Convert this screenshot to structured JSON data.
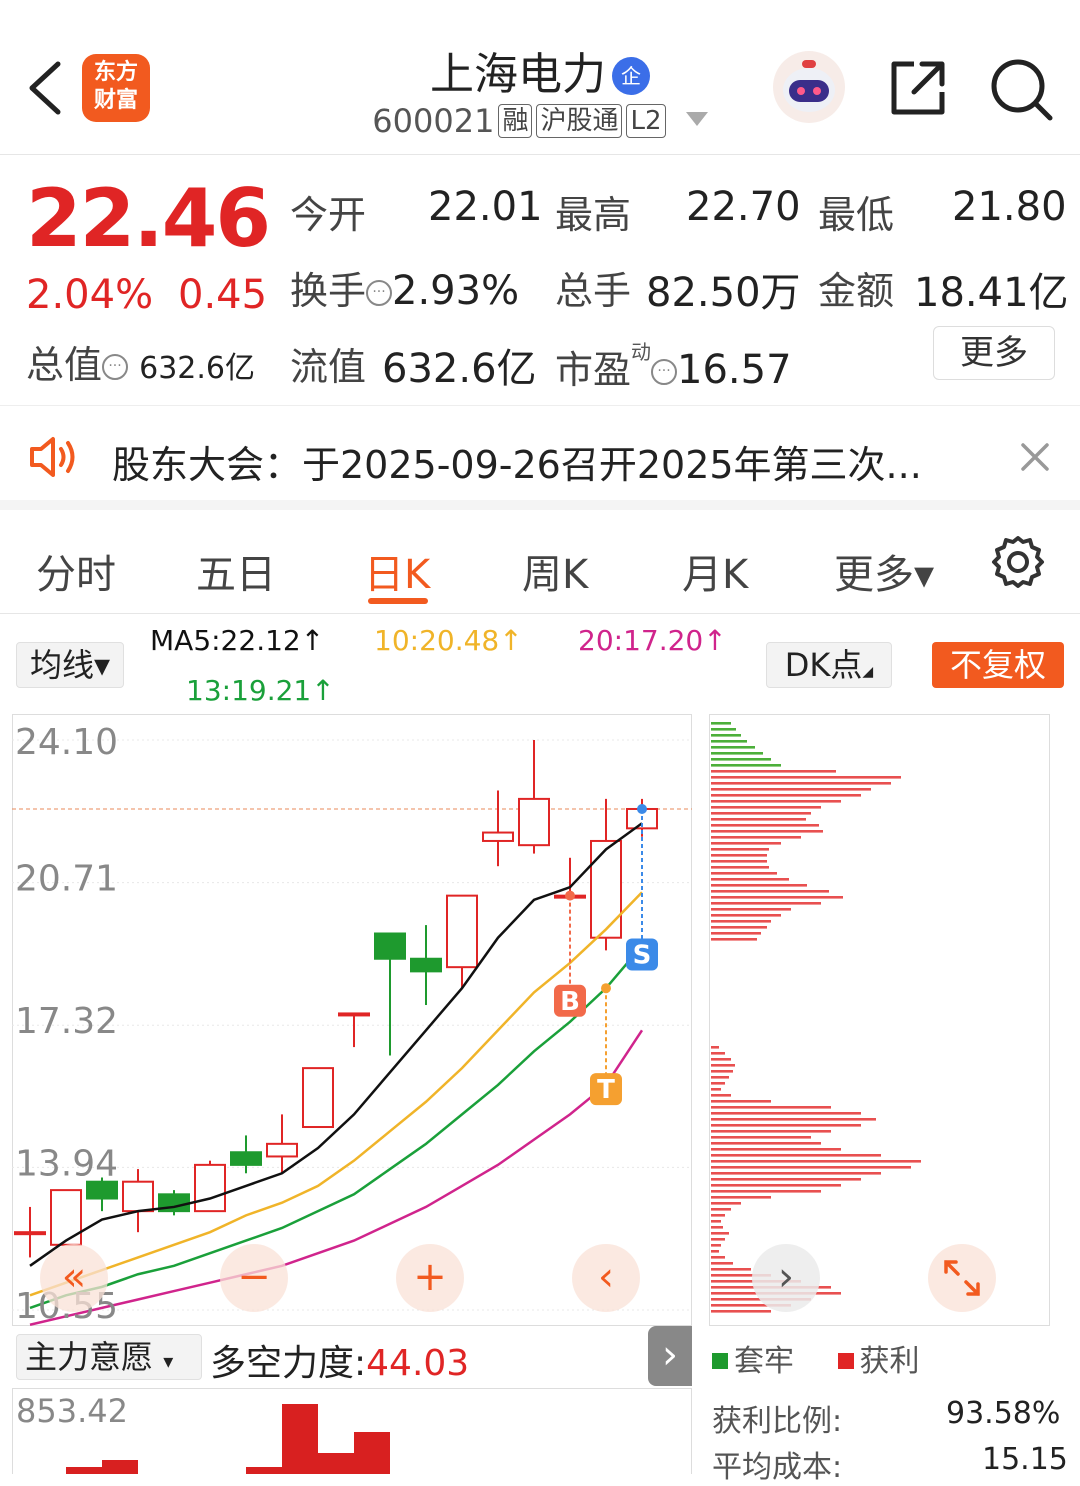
{
  "header": {
    "logo_line1": "东方",
    "logo_line2": "财富",
    "stock_name": "上海电力",
    "badge_qiye": "企",
    "code": "600021",
    "tags": [
      "融",
      "沪股通",
      "L2"
    ]
  },
  "quote": {
    "price": "22.46",
    "change_pct": "2.04%",
    "change": "0.45",
    "total_value_label": "总值",
    "total_value": "632.6亿",
    "open_label": "今开",
    "open": "22.01",
    "high_label": "最高",
    "high": "22.70",
    "low_label": "最低",
    "low": "21.80",
    "turnover_label": "换手",
    "turnover": "2.93%",
    "volume_label": "总手",
    "volume": "82.50万",
    "amount_label": "金额",
    "amount": "18.41亿",
    "float_label": "流值",
    "float_value": "632.6亿",
    "pe_label": "市盈",
    "pe_sup": "动",
    "pe": "16.57",
    "more_label": "更多"
  },
  "notice": {
    "text": "股东大会：于2025-09-26召开2025年第三次..."
  },
  "tabs": [
    {
      "label": "分时",
      "active": false
    },
    {
      "label": "五日",
      "active": false
    },
    {
      "label": "日K",
      "active": true
    },
    {
      "label": "周K",
      "active": false
    },
    {
      "label": "月K",
      "active": false
    },
    {
      "label": "更多▾",
      "active": false
    }
  ],
  "indicators": {
    "ma_select": "均线▾",
    "ma5": "MA5:22.12↑",
    "ma10": "10:20.48↑",
    "ma20": "20:17.20↑",
    "ma13": "13:19.21↑",
    "dk_label": "DK点",
    "fuquan": "不复权"
  },
  "colors": {
    "accent": "#f25a1f",
    "up": "#e02525",
    "down": "#1e9a2e",
    "ma5": "#111111",
    "ma10": "#f0b429",
    "ma13": "#1aa03a",
    "ma20": "#d0248c"
  },
  "chart_data": [
    {
      "type": "candlestick",
      "y_ticks": [
        "24.10",
        "20.71",
        "17.32",
        "13.94",
        "10.55"
      ],
      "ylim": [
        10.55,
        24.1
      ],
      "candles": [
        {
          "o": 12.4,
          "c": 12.4,
          "h": 13.0,
          "l": 11.8
        },
        {
          "o": 12.1,
          "c": 13.4,
          "h": 13.4,
          "l": 12.1
        },
        {
          "o": 13.6,
          "c": 13.2,
          "h": 13.7,
          "l": 12.9
        },
        {
          "o": 12.9,
          "c": 13.6,
          "h": 13.9,
          "l": 12.4
        },
        {
          "o": 13.3,
          "c": 12.9,
          "h": 13.4,
          "l": 12.8
        },
        {
          "o": 12.9,
          "c": 14.0,
          "h": 14.1,
          "l": 12.9
        },
        {
          "o": 14.3,
          "c": 14.0,
          "h": 14.7,
          "l": 13.8
        },
        {
          "o": 14.2,
          "c": 14.5,
          "h": 15.2,
          "l": 13.8
        },
        {
          "o": 14.9,
          "c": 16.3,
          "h": 16.3,
          "l": 14.9
        },
        {
          "o": 17.6,
          "c": 17.6,
          "h": 17.6,
          "l": 16.8
        },
        {
          "o": 19.5,
          "c": 18.9,
          "h": 19.5,
          "l": 16.6
        },
        {
          "o": 18.9,
          "c": 18.6,
          "h": 19.7,
          "l": 17.8
        },
        {
          "o": 18.7,
          "c": 20.4,
          "h": 20.4,
          "l": 18.2
        },
        {
          "o": 21.7,
          "c": 21.9,
          "h": 22.9,
          "l": 21.1
        },
        {
          "o": 21.6,
          "c": 22.7,
          "h": 24.1,
          "l": 21.4
        },
        {
          "o": 20.4,
          "c": 20.4,
          "h": 21.3,
          "l": 20.4
        },
        {
          "o": 19.4,
          "c": 21.7,
          "h": 22.7,
          "l": 19.1
        },
        {
          "o": 22.0,
          "c": 22.46,
          "h": 22.7,
          "l": 21.8
        }
      ],
      "ma5": [
        11.6,
        12.2,
        12.7,
        12.9,
        13.0,
        13.2,
        13.5,
        13.8,
        14.4,
        15.2,
        16.2,
        17.2,
        18.2,
        19.4,
        20.3,
        20.6,
        21.5,
        22.12
      ],
      "ma10": [
        10.9,
        11.2,
        11.5,
        11.8,
        12.1,
        12.4,
        12.8,
        13.1,
        13.5,
        14.1,
        14.8,
        15.5,
        16.3,
        17.2,
        18.1,
        18.8,
        19.6,
        20.48
      ],
      "ma13": [
        10.6,
        10.9,
        11.1,
        11.4,
        11.6,
        11.9,
        12.2,
        12.5,
        12.9,
        13.3,
        13.9,
        14.5,
        15.2,
        15.9,
        16.7,
        17.4,
        18.2,
        19.21
      ],
      "ma20": [
        10.2,
        10.4,
        10.6,
        10.8,
        11.0,
        11.2,
        11.4,
        11.6,
        11.9,
        12.2,
        12.6,
        13.0,
        13.5,
        14.0,
        14.6,
        15.2,
        15.9,
        17.2
      ],
      "markers": [
        "B",
        "S",
        "T"
      ]
    },
    {
      "type": "bar",
      "orientation": "horizontal",
      "legend": [
        "套牢",
        "获利"
      ]
    },
    {
      "type": "bar",
      "y_ticks": [
        "853.42"
      ],
      "values": [
        0,
        1,
        2,
        0,
        0,
        0,
        1,
        10,
        3,
        6,
        0
      ]
    }
  ],
  "chip_legend": {
    "locked": "套牢",
    "profit": "获利"
  },
  "chip_stats": {
    "profit_ratio_label": "获利比例:",
    "profit_ratio": "93.58%",
    "avg_cost_label": "平均成本:",
    "avg_cost": "15.15"
  },
  "sub_indicator": {
    "select": "主力意愿",
    "label": "多空力度:",
    "value": "44.03",
    "top_tick": "853.42"
  }
}
